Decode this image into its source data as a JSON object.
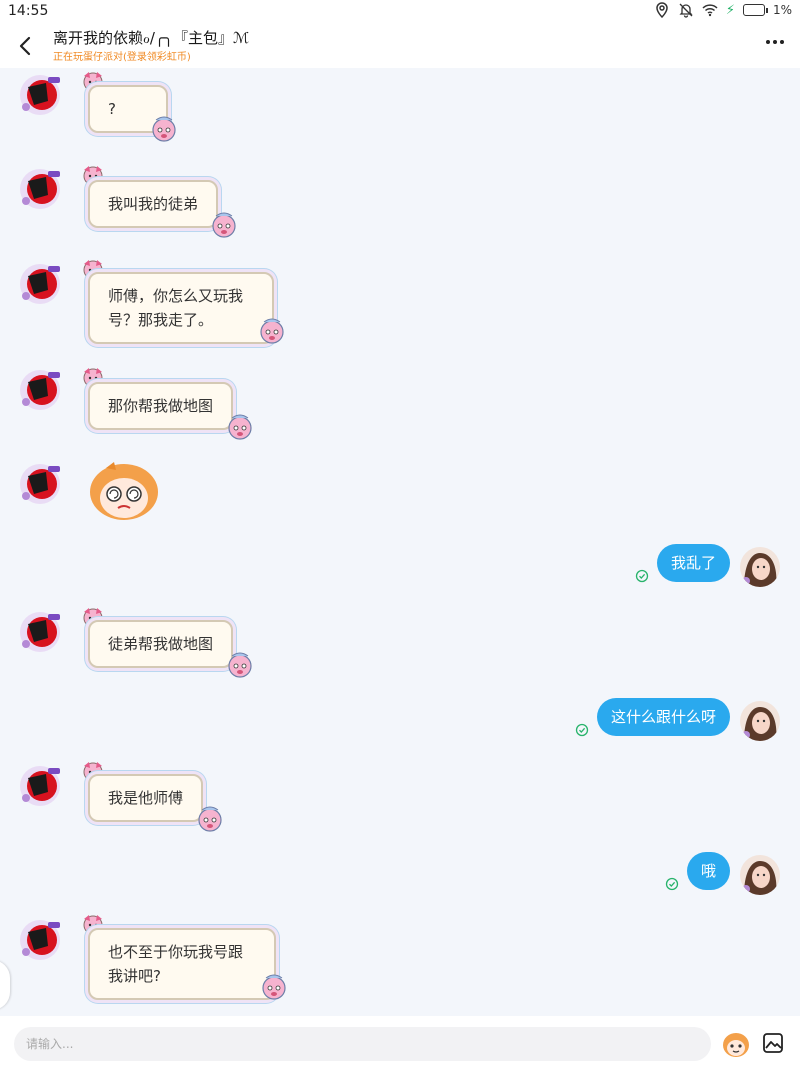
{
  "status_bar": {
    "time": "14:55",
    "battery": "1%"
  },
  "header": {
    "title": "离开我的依赖ℴ/╭╮『主包』ℳ",
    "subtitle": "正在玩蛋仔派对(登录领彩虹币)"
  },
  "messages": [
    {
      "side": "left",
      "type": "text",
      "text": "?"
    },
    {
      "side": "left",
      "type": "text",
      "text": "我叫我的徒弟"
    },
    {
      "side": "left",
      "type": "text",
      "text": "师傅，你怎么又玩我号？那我走了。",
      "line1": "师傅，你怎么又玩我",
      "line2": "号？那我走了。"
    },
    {
      "side": "left",
      "type": "text",
      "text": "那你帮我做地图"
    },
    {
      "side": "left",
      "type": "sticker",
      "sticker": "dizzy-face-sticker"
    },
    {
      "side": "right",
      "type": "text",
      "text": "我乱了"
    },
    {
      "side": "left",
      "type": "text",
      "text": "徒弟帮我做地图"
    },
    {
      "side": "right",
      "type": "text",
      "text": "这什么跟什么呀"
    },
    {
      "side": "left",
      "type": "text",
      "text": "我是他师傅"
    },
    {
      "side": "right",
      "type": "text",
      "text": "哦"
    },
    {
      "side": "left",
      "type": "text",
      "text": "也不至于你玩我号跟我讲吧?",
      "line1": "也不至于你玩我号跟",
      "line2": "我讲吧?"
    }
  ],
  "input": {
    "placeholder": "请输入..."
  },
  "icons": {
    "back": "chevron-left-icon",
    "more": "more-dots-icon",
    "emoji": "emoji-face-icon",
    "image": "image-icon",
    "read": "check-circle-icon",
    "location": "location-icon",
    "mute": "bell-off-icon",
    "wifi": "wifi-icon"
  },
  "colors": {
    "accent_blue": "#2aa9ee",
    "subtitle_orange": "#f08a24",
    "read_green": "#27b36b",
    "bubble_border": "#d4c9b4"
  }
}
